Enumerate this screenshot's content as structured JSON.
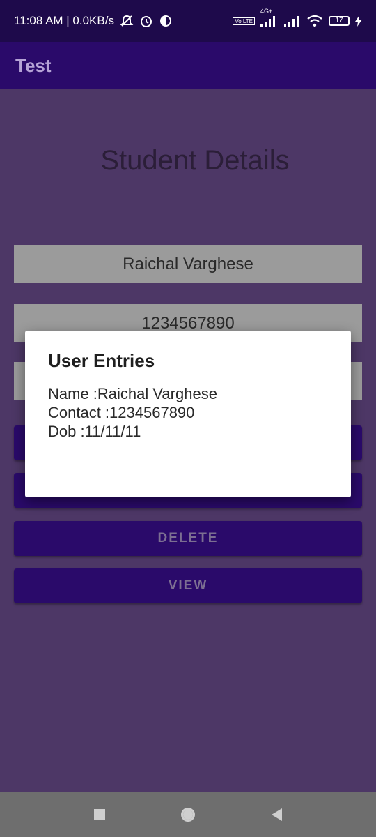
{
  "status_bar": {
    "time_speed": "11:08 AM | 0.0KB/s",
    "network_label": "4G+",
    "volte_label": "Vo LTE",
    "battery": "17",
    "icons": [
      "mute-icon",
      "alarm-icon",
      "app-status-icon",
      "volte-icon",
      "signal-icon",
      "signal-icon",
      "wifi-icon",
      "battery-icon",
      "charging-icon"
    ]
  },
  "app_bar": {
    "title": "Test"
  },
  "main": {
    "title": "Student Details",
    "name_value": "Raichal Varghese",
    "contact_value": "1234567890",
    "buttons": {
      "delete": "DELETE",
      "view": "VIEW"
    }
  },
  "dialog": {
    "title": "User Entries",
    "lines": {
      "name": "Name :Raichal Varghese",
      "contact": "Contact :1234567890",
      "dob": "Dob :11/11/11"
    }
  },
  "colors": {
    "status_bar": "#1e0a4b",
    "app_bar": "#2a0a6a",
    "scrim_background": "#4d3766",
    "button": "#2a0a6a",
    "dialog": "#ffffff"
  }
}
